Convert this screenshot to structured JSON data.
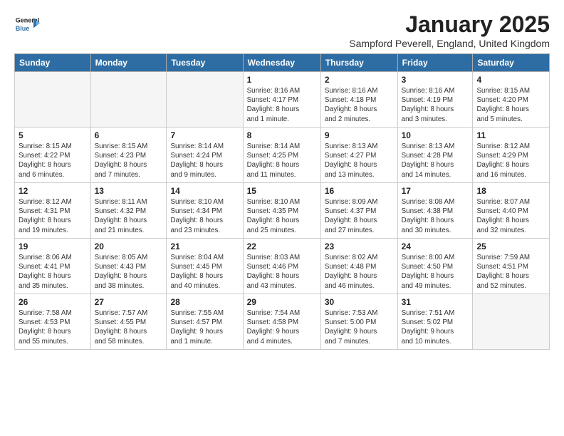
{
  "logo": {
    "line1": "General",
    "line2": "Blue"
  },
  "title": "January 2025",
  "subtitle": "Sampford Peverell, England, United Kingdom",
  "days_of_week": [
    "Sunday",
    "Monday",
    "Tuesday",
    "Wednesday",
    "Thursday",
    "Friday",
    "Saturday"
  ],
  "weeks": [
    [
      {
        "day": "",
        "info": ""
      },
      {
        "day": "",
        "info": ""
      },
      {
        "day": "",
        "info": ""
      },
      {
        "day": "1",
        "info": "Sunrise: 8:16 AM\nSunset: 4:17 PM\nDaylight: 8 hours\nand 1 minute."
      },
      {
        "day": "2",
        "info": "Sunrise: 8:16 AM\nSunset: 4:18 PM\nDaylight: 8 hours\nand 2 minutes."
      },
      {
        "day": "3",
        "info": "Sunrise: 8:16 AM\nSunset: 4:19 PM\nDaylight: 8 hours\nand 3 minutes."
      },
      {
        "day": "4",
        "info": "Sunrise: 8:15 AM\nSunset: 4:20 PM\nDaylight: 8 hours\nand 5 minutes."
      }
    ],
    [
      {
        "day": "5",
        "info": "Sunrise: 8:15 AM\nSunset: 4:22 PM\nDaylight: 8 hours\nand 6 minutes."
      },
      {
        "day": "6",
        "info": "Sunrise: 8:15 AM\nSunset: 4:23 PM\nDaylight: 8 hours\nand 7 minutes."
      },
      {
        "day": "7",
        "info": "Sunrise: 8:14 AM\nSunset: 4:24 PM\nDaylight: 8 hours\nand 9 minutes."
      },
      {
        "day": "8",
        "info": "Sunrise: 8:14 AM\nSunset: 4:25 PM\nDaylight: 8 hours\nand 11 minutes."
      },
      {
        "day": "9",
        "info": "Sunrise: 8:13 AM\nSunset: 4:27 PM\nDaylight: 8 hours\nand 13 minutes."
      },
      {
        "day": "10",
        "info": "Sunrise: 8:13 AM\nSunset: 4:28 PM\nDaylight: 8 hours\nand 14 minutes."
      },
      {
        "day": "11",
        "info": "Sunrise: 8:12 AM\nSunset: 4:29 PM\nDaylight: 8 hours\nand 16 minutes."
      }
    ],
    [
      {
        "day": "12",
        "info": "Sunrise: 8:12 AM\nSunset: 4:31 PM\nDaylight: 8 hours\nand 19 minutes."
      },
      {
        "day": "13",
        "info": "Sunrise: 8:11 AM\nSunset: 4:32 PM\nDaylight: 8 hours\nand 21 minutes."
      },
      {
        "day": "14",
        "info": "Sunrise: 8:10 AM\nSunset: 4:34 PM\nDaylight: 8 hours\nand 23 minutes."
      },
      {
        "day": "15",
        "info": "Sunrise: 8:10 AM\nSunset: 4:35 PM\nDaylight: 8 hours\nand 25 minutes."
      },
      {
        "day": "16",
        "info": "Sunrise: 8:09 AM\nSunset: 4:37 PM\nDaylight: 8 hours\nand 27 minutes."
      },
      {
        "day": "17",
        "info": "Sunrise: 8:08 AM\nSunset: 4:38 PM\nDaylight: 8 hours\nand 30 minutes."
      },
      {
        "day": "18",
        "info": "Sunrise: 8:07 AM\nSunset: 4:40 PM\nDaylight: 8 hours\nand 32 minutes."
      }
    ],
    [
      {
        "day": "19",
        "info": "Sunrise: 8:06 AM\nSunset: 4:41 PM\nDaylight: 8 hours\nand 35 minutes."
      },
      {
        "day": "20",
        "info": "Sunrise: 8:05 AM\nSunset: 4:43 PM\nDaylight: 8 hours\nand 38 minutes."
      },
      {
        "day": "21",
        "info": "Sunrise: 8:04 AM\nSunset: 4:45 PM\nDaylight: 8 hours\nand 40 minutes."
      },
      {
        "day": "22",
        "info": "Sunrise: 8:03 AM\nSunset: 4:46 PM\nDaylight: 8 hours\nand 43 minutes."
      },
      {
        "day": "23",
        "info": "Sunrise: 8:02 AM\nSunset: 4:48 PM\nDaylight: 8 hours\nand 46 minutes."
      },
      {
        "day": "24",
        "info": "Sunrise: 8:00 AM\nSunset: 4:50 PM\nDaylight: 8 hours\nand 49 minutes."
      },
      {
        "day": "25",
        "info": "Sunrise: 7:59 AM\nSunset: 4:51 PM\nDaylight: 8 hours\nand 52 minutes."
      }
    ],
    [
      {
        "day": "26",
        "info": "Sunrise: 7:58 AM\nSunset: 4:53 PM\nDaylight: 8 hours\nand 55 minutes."
      },
      {
        "day": "27",
        "info": "Sunrise: 7:57 AM\nSunset: 4:55 PM\nDaylight: 8 hours\nand 58 minutes."
      },
      {
        "day": "28",
        "info": "Sunrise: 7:55 AM\nSunset: 4:57 PM\nDaylight: 9 hours\nand 1 minute."
      },
      {
        "day": "29",
        "info": "Sunrise: 7:54 AM\nSunset: 4:58 PM\nDaylight: 9 hours\nand 4 minutes."
      },
      {
        "day": "30",
        "info": "Sunrise: 7:53 AM\nSunset: 5:00 PM\nDaylight: 9 hours\nand 7 minutes."
      },
      {
        "day": "31",
        "info": "Sunrise: 7:51 AM\nSunset: 5:02 PM\nDaylight: 9 hours\nand 10 minutes."
      },
      {
        "day": "",
        "info": ""
      }
    ]
  ]
}
